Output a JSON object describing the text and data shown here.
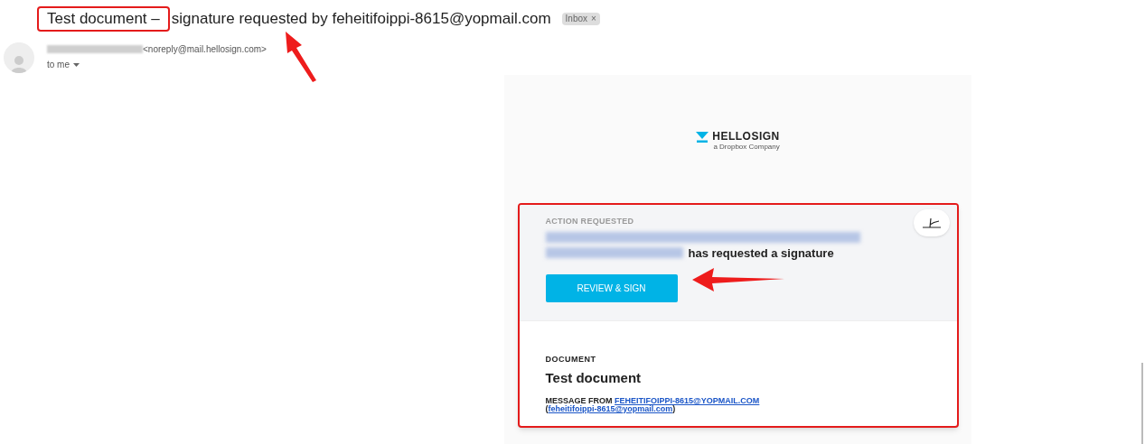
{
  "email": {
    "subject": [
      {
        "text": "Test document –",
        "highlighted": true
      },
      {
        "text": "signature requested by feheitifoippi-8615@yopmail.com",
        "highlighted": false
      }
    ],
    "label": "Inbox",
    "label_close": "×",
    "sender_address": "<noreply@mail.hellosign.com>",
    "recipient": "to me"
  },
  "body": {
    "logo": {
      "name": "HELLOSIGN",
      "tagline": "a Dropbox Company"
    },
    "action": {
      "heading": "ACTION REQUESTED",
      "request": "has requested a signature",
      "button": "REVIEW & SIGN"
    },
    "document": {
      "heading": "DOCUMENT",
      "title": "Test document",
      "message_prefix": "MESSAGE FROM",
      "sender_link": "FEHEITIFOIPPI-8615@YOPMAIL.COM",
      "email_open": "(",
      "email_link": "feheitifoippi-8615@yopmail.com",
      "email_close": ")"
    }
  }
}
